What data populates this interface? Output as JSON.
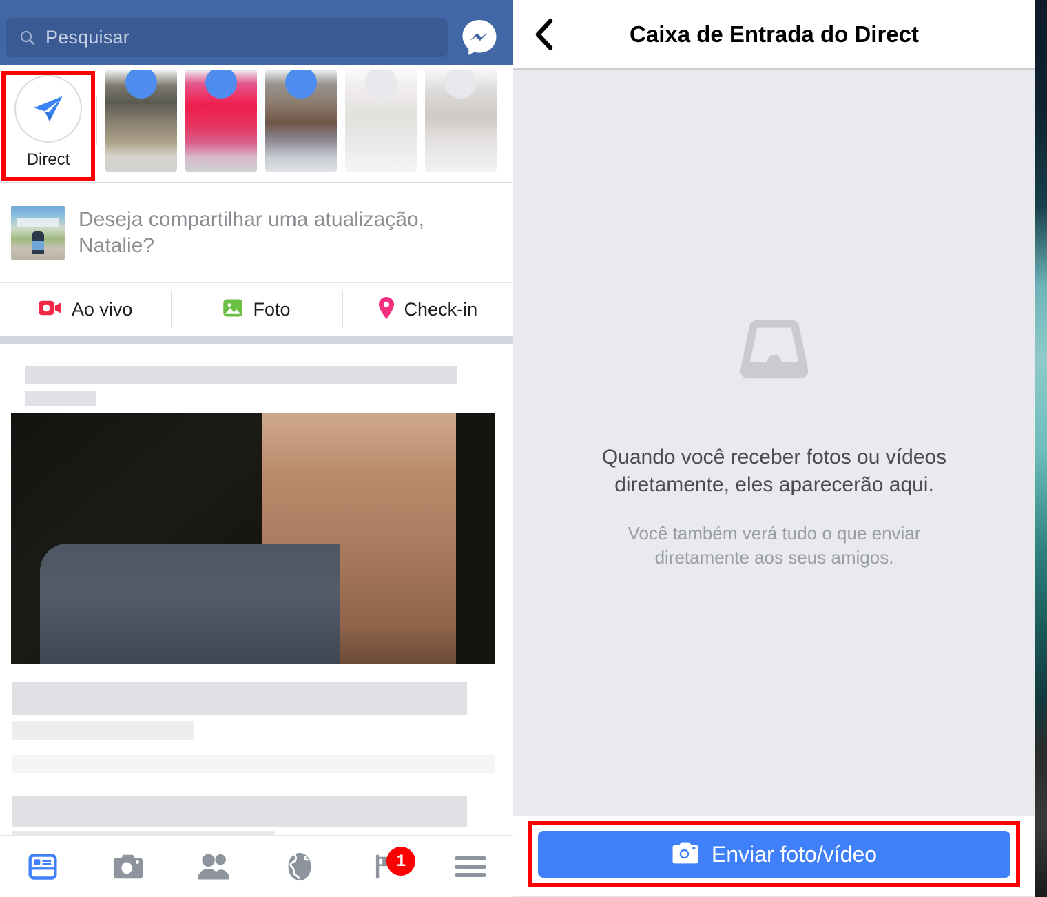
{
  "left_panel": {
    "topbar": {
      "search_placeholder": "Pesquisar",
      "search_icon": "search-icon",
      "messenger_icon": "messenger-icon",
      "bar_color": "#4267a6",
      "field_color": "#395a92"
    },
    "stories": {
      "direct": {
        "label": "Direct",
        "icon": "paper-plane-icon"
      },
      "items": [
        {
          "name": "story-1"
        },
        {
          "name": "story-2"
        },
        {
          "name": "story-3"
        },
        {
          "name": "story-4"
        },
        {
          "name": "story-5"
        }
      ]
    },
    "composer": {
      "avatar": "user-avatar",
      "prompt": "Deseja compartilhar uma atualização, Natalie?"
    },
    "actions": [
      {
        "label": "Ao vivo",
        "icon": "live-video-icon",
        "color": "#f02849"
      },
      {
        "label": "Foto",
        "icon": "photo-icon",
        "color": "#6bbf43"
      },
      {
        "label": "Check-in",
        "icon": "location-pin-icon",
        "color": "#f5317f"
      }
    ],
    "feed": {
      "post_image": "post-photo"
    },
    "bottom_nav": [
      {
        "name": "news-feed-tab",
        "icon": "news-feed-icon",
        "active": true,
        "badge": ""
      },
      {
        "name": "camera-tab",
        "icon": "camera-icon",
        "active": false,
        "badge": ""
      },
      {
        "name": "friends-tab",
        "icon": "friends-icon",
        "active": false,
        "badge": ""
      },
      {
        "name": "notifications-globe-tab",
        "icon": "globe-icon",
        "active": false,
        "badge": ""
      },
      {
        "name": "flag-tab",
        "icon": "flag-icon",
        "active": false,
        "badge": "1"
      },
      {
        "name": "menu-tab",
        "icon": "hamburger-menu-icon",
        "active": false,
        "badge": ""
      }
    ]
  },
  "right_panel": {
    "header": {
      "back_icon": "chevron-left-icon",
      "title": "Caixa de Entrada do Direct"
    },
    "empty_state": {
      "icon": "inbox-tray-icon",
      "title": "Quando você receber fotos ou vídeos diretamente, eles aparecerão aqui.",
      "subtitle": "Você também verá tudo o que enviar diretamente aos seus amigos."
    },
    "footer": {
      "send_label": "Enviar foto/vídeo",
      "send_icon": "camera-icon",
      "button_color": "#4080fb"
    }
  },
  "annotations": {
    "highlight_color": "#fe0000",
    "boxes": [
      {
        "name": "direct-button-highlight"
      },
      {
        "name": "send-photo-video-highlight"
      }
    ]
  }
}
